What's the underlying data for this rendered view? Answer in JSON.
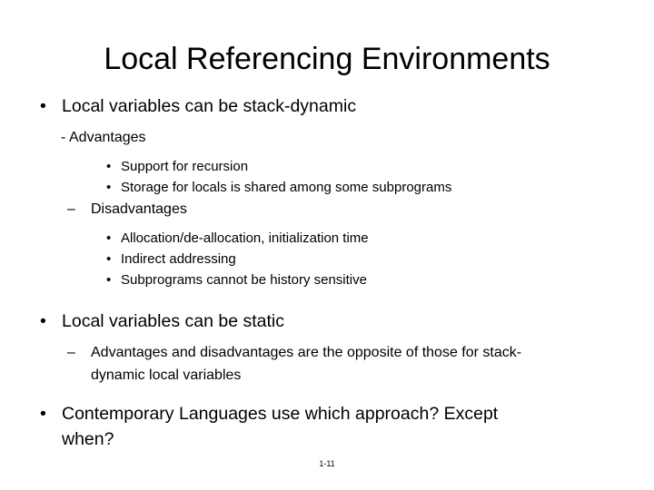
{
  "slide": {
    "title": "Local Referencing Environments",
    "footer": "1-11",
    "background_color": "#ffffff",
    "text_color": "#000000",
    "bullets": {
      "b1_mark": "•",
      "b1_text": "Local variables can be stack-dynamic",
      "b1_1_mark": "-",
      "b1_1_text": "Advantages",
      "b1_1_1_mark": "•",
      "b1_1_1_text": "Support for recursion",
      "b1_1_2_mark": "•",
      "b1_1_2_text": "Storage for locals is shared among some subprograms",
      "b1_2_mark": "–",
      "b1_2_text": "Disadvantages",
      "b1_2_1_mark": "•",
      "b1_2_1_text": "Allocation/de-allocation, initialization time",
      "b1_2_2_mark": "•",
      "b1_2_2_text": "Indirect addressing",
      "b1_2_3_mark": "•",
      "b1_2_3_text": "Subprograms cannot be history sensitive",
      "b2_mark": "•",
      "b2_text": "Local variables can be static",
      "b2_1_mark": "–",
      "b2_1_text_line1": "Advantages and disadvantages are the opposite of those for stack-",
      "b2_1_text_line2": "dynamic local variables",
      "b3_mark": "•",
      "b3_text_line1": "Contemporary Languages use which approach?  Except",
      "b3_text_line2": "when?"
    }
  }
}
